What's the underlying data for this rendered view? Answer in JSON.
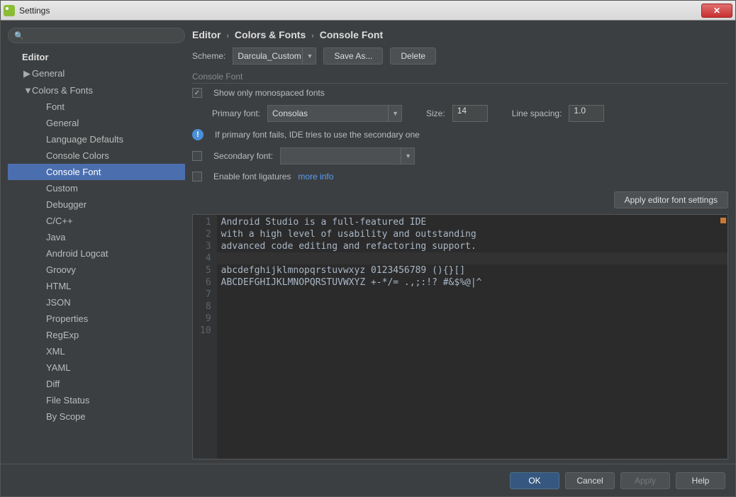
{
  "window": {
    "title": "Settings"
  },
  "sidebar": {
    "header": "Editor",
    "general": "General",
    "colorsFonts": "Colors & Fonts",
    "items": [
      "Font",
      "General",
      "Language Defaults",
      "Console Colors",
      "Console Font",
      "Custom",
      "Debugger",
      "C/C++",
      "Java",
      "Android Logcat",
      "Groovy",
      "HTML",
      "JSON",
      "Properties",
      "RegExp",
      "XML",
      "YAML",
      "Diff",
      "File Status",
      "By Scope"
    ],
    "selectedIndex": 4
  },
  "breadcrumb": {
    "a": "Editor",
    "b": "Colors & Fonts",
    "c": "Console Font"
  },
  "scheme": {
    "label": "Scheme:",
    "value": "Darcula_Custom",
    "saveAs": "Save As...",
    "delete": "Delete"
  },
  "section": {
    "title": "Console Font"
  },
  "monospaced": {
    "label": "Show only monospaced fonts",
    "checked": true
  },
  "primary": {
    "label": "Primary font:",
    "value": "Consolas",
    "sizeLabel": "Size:",
    "size": "14",
    "spacingLabel": "Line spacing:",
    "spacing": "1.0"
  },
  "fallbackInfo": "If primary font fails, IDE tries to use the secondary one",
  "secondary": {
    "label": "Secondary font:",
    "checked": false,
    "value": ""
  },
  "ligatures": {
    "label": "Enable font ligatures",
    "checked": false,
    "moreInfo": "more info"
  },
  "applyEditor": "Apply editor font settings",
  "preview": {
    "lines": [
      "Android Studio is a full-featured IDE",
      "with a high level of usability and outstanding",
      "advanced code editing and refactoring support.",
      "",
      "abcdefghijklmnopqrstuvwxyz 0123456789 (){}[]",
      "ABCDEFGHIJKLMNOPQRSTUVWXYZ +-*/= .,;:!? #&$%@|^",
      "",
      "",
      "",
      ""
    ]
  },
  "footer": {
    "ok": "OK",
    "cancel": "Cancel",
    "apply": "Apply",
    "help": "Help"
  }
}
